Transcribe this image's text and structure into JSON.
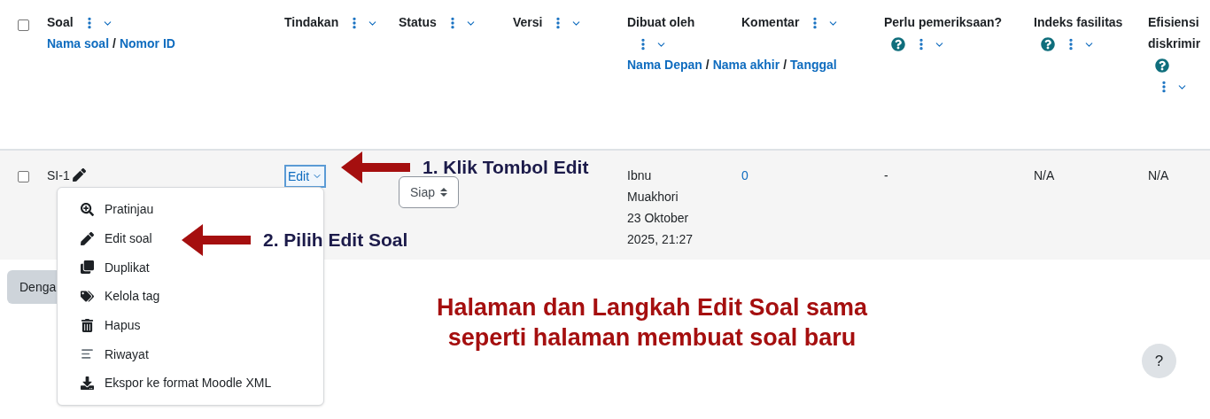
{
  "table": {
    "select_all": {
      "checked": false
    },
    "columns": [
      {
        "label": "Soal",
        "menu": true,
        "help": false,
        "sort_links": [
          "Nama soal",
          "Nomor ID"
        ],
        "separator": "/"
      },
      {
        "label": "Tindakan",
        "menu": true,
        "help": false
      },
      {
        "label": "Status",
        "menu": true,
        "help": false
      },
      {
        "label": "Versi",
        "menu": true,
        "help": false
      },
      {
        "label": "Dibuat oleh",
        "menu": true,
        "help": false,
        "sort_links": [
          "Nama Depan",
          "Nama akhir",
          "Tanggal"
        ],
        "separator": "/"
      },
      {
        "label": "Komentar",
        "menu": true,
        "help": false
      },
      {
        "label": "Perlu pemeriksaan?",
        "menu": true,
        "help": true
      },
      {
        "label": "Indeks fasilitas",
        "menu": true,
        "help": true
      },
      {
        "label": "Efisiensi diskrimir",
        "menu": true,
        "help": true
      }
    ],
    "rows": [
      {
        "checked": false,
        "name": "SI-1",
        "action": {
          "label": "Edit",
          "focused": true
        },
        "status": "Siap",
        "created_by": "Ibnu Muakhori",
        "created_at": "23 Oktober 2025, 21:27",
        "comments": "0",
        "needs_review": "-",
        "facility_index": "N/A",
        "discrimination": "N/A"
      }
    ]
  },
  "action_menu": {
    "expanded": true,
    "items": [
      {
        "kind": "zoom",
        "label": "Pratinjau"
      },
      {
        "kind": "pencil",
        "label": "Edit soal"
      },
      {
        "kind": "copy",
        "label": "Duplikat"
      },
      {
        "kind": "tag",
        "label": "Kelola tag"
      },
      {
        "kind": "trash",
        "label": "Hapus"
      },
      {
        "kind": "history",
        "label": "Riwayat"
      },
      {
        "kind": "download",
        "label": "Ekspor ke format Moodle XML"
      }
    ]
  },
  "bulk_button": "Denga",
  "annotations": [
    {
      "kind": "arrow_label",
      "text": "1. Klik Tombol Edit"
    },
    {
      "kind": "arrow_label",
      "text": "2. Pilih Edit Soal"
    }
  ],
  "note": [
    "Halaman dan Langkah Edit Soal sama",
    "seperti halaman membuat soal baru"
  ],
  "help_button": "?"
}
